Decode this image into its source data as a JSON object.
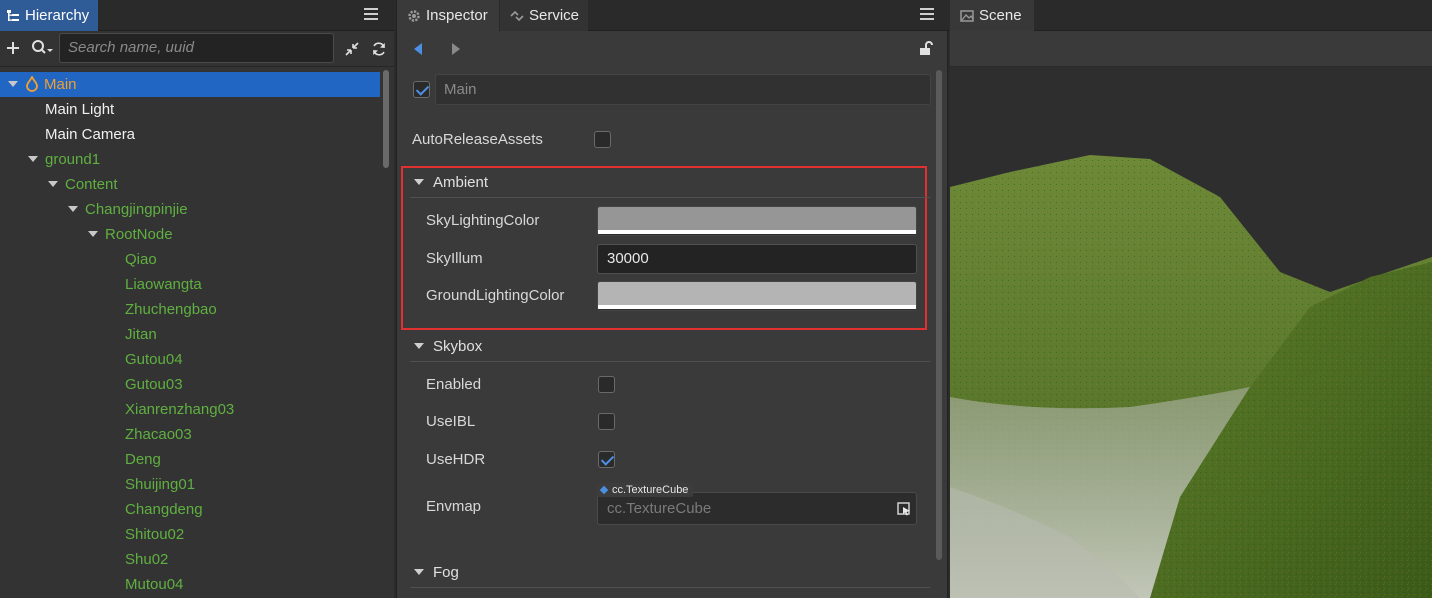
{
  "hierarchy": {
    "tab_label": "Hierarchy",
    "search_placeholder": "Search name, uuid",
    "tree": [
      {
        "label": "Main",
        "color": "orange",
        "expanded": true,
        "depth": 0,
        "selected": true
      },
      {
        "label": "Main Light",
        "color": "white",
        "depth": 1
      },
      {
        "label": "Main Camera",
        "color": "white",
        "depth": 1
      },
      {
        "label": "ground1",
        "color": "green",
        "expanded": true,
        "depth": 1
      },
      {
        "label": "Content",
        "color": "green",
        "expanded": true,
        "depth": 2
      },
      {
        "label": "Changjingpinjie",
        "color": "green",
        "expanded": true,
        "depth": 3
      },
      {
        "label": "RootNode",
        "color": "green",
        "expanded": true,
        "depth": 4
      },
      {
        "label": "Qiao",
        "color": "green",
        "depth": 5
      },
      {
        "label": "Liaowangta",
        "color": "green",
        "depth": 5
      },
      {
        "label": "Zhuchengbao",
        "color": "green",
        "depth": 5
      },
      {
        "label": "Jitan",
        "color": "green",
        "depth": 5
      },
      {
        "label": "Gutou04",
        "color": "green",
        "depth": 5
      },
      {
        "label": "Gutou03",
        "color": "green",
        "depth": 5
      },
      {
        "label": "Xianrenzhang03",
        "color": "green",
        "depth": 5
      },
      {
        "label": "Zhacao03",
        "color": "green",
        "depth": 5
      },
      {
        "label": "Deng",
        "color": "green",
        "depth": 5
      },
      {
        "label": "Shuijing01",
        "color": "green",
        "depth": 5
      },
      {
        "label": "Changdeng",
        "color": "green",
        "depth": 5
      },
      {
        "label": "Shitou02",
        "color": "green",
        "depth": 5
      },
      {
        "label": "Shu02",
        "color": "green",
        "depth": 5
      },
      {
        "label": "Mutou04",
        "color": "green",
        "depth": 5
      }
    ]
  },
  "inspector": {
    "tab_inspector": "Inspector",
    "tab_service": "Service",
    "node_name": "Main",
    "node_active": true,
    "auto_release_label": "AutoReleaseAssets",
    "auto_release_checked": false,
    "ambient": {
      "title": "Ambient",
      "sky_lighting_color_label": "SkyLightingColor",
      "sky_lighting_color": "#969696",
      "sky_illum_label": "SkyIllum",
      "sky_illum_value": "30000",
      "ground_lighting_color_label": "GroundLightingColor",
      "ground_lighting_color": "#b4b4b4"
    },
    "skybox": {
      "title": "Skybox",
      "enabled_label": "Enabled",
      "enabled": false,
      "use_ibl_label": "UseIBL",
      "use_ibl": false,
      "use_hdr_label": "UseHDR",
      "use_hdr": true,
      "envmap_label": "Envmap",
      "envmap_type": "cc.TextureCube",
      "envmap_placeholder": "cc.TextureCube"
    },
    "fog": {
      "title": "Fog"
    }
  },
  "scene": {
    "tab_label": "Scene"
  },
  "colors": {
    "accent": "#2266c4",
    "highlight_border": "#e03030",
    "node_green": "#5fb040",
    "node_orange": "#f0a030"
  }
}
